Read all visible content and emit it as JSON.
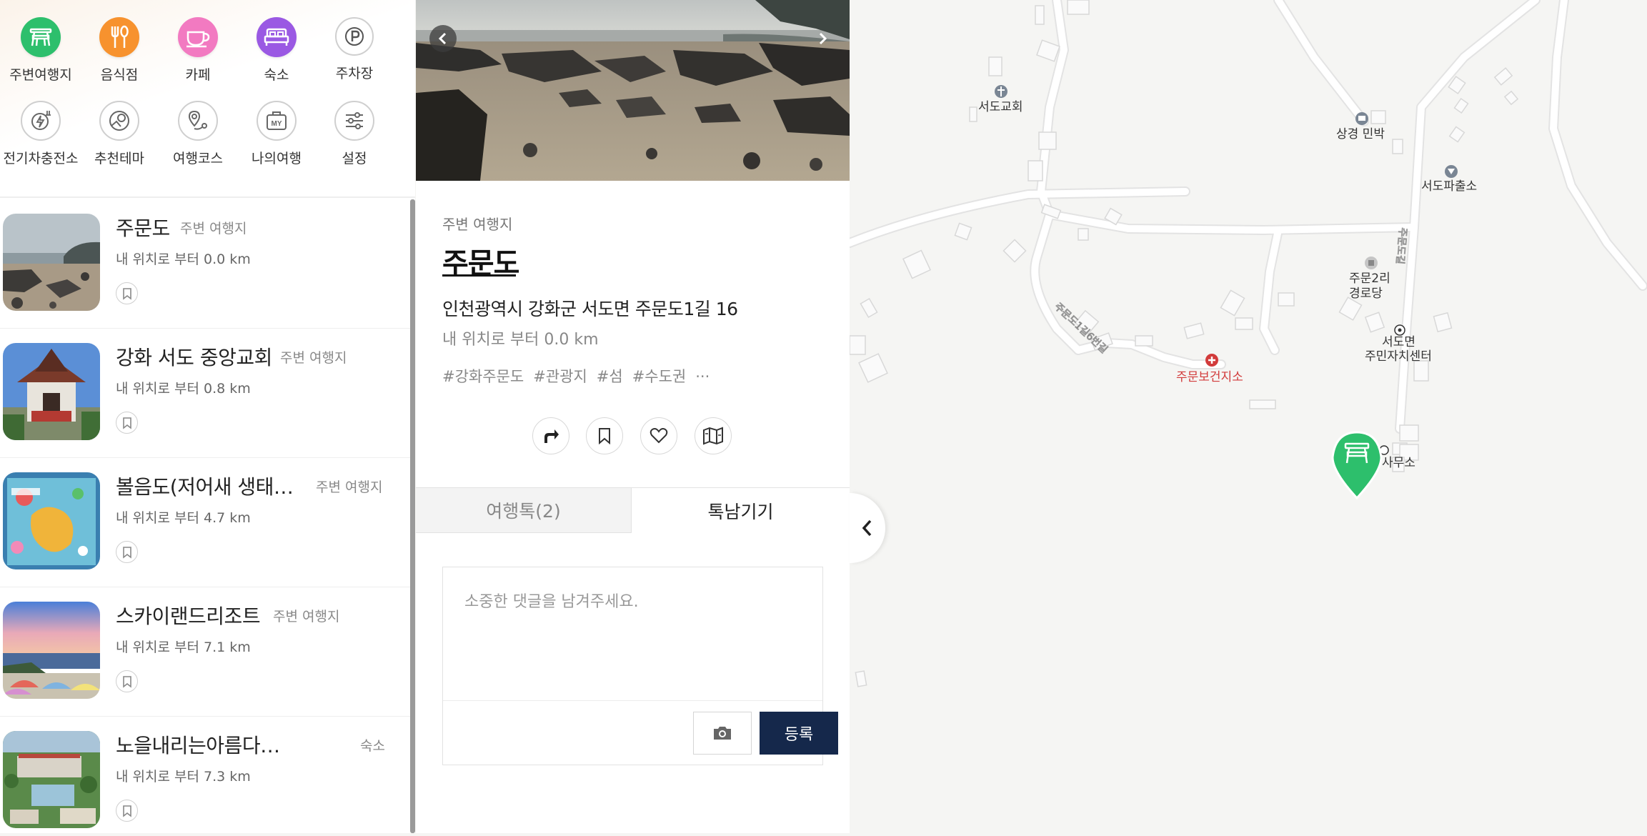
{
  "categories_row1": [
    {
      "label": "주변여행지",
      "icon": "picnic-table-icon",
      "color": "#2dbf6c"
    },
    {
      "label": "음식점",
      "icon": "fork-spoon-icon",
      "color": "#f7922e"
    },
    {
      "label": "카페",
      "icon": "coffee-cup-icon",
      "color": "#f27ac1"
    },
    {
      "label": "숙소",
      "icon": "bed-icon",
      "color": "#9a59e3"
    },
    {
      "label": "주차장",
      "icon": "parking-icon",
      "color": "#ffffff"
    }
  ],
  "categories_row2": [
    {
      "label": "전기차충전소",
      "icon": "ev-charger-icon"
    },
    {
      "label": "추천테마",
      "icon": "theme-compass-icon"
    },
    {
      "label": "여행코스",
      "icon": "route-pin-icon"
    },
    {
      "label": "나의여행",
      "icon": "my-bag-icon"
    },
    {
      "label": "설정",
      "icon": "settings-sliders-icon"
    }
  ],
  "list": {
    "items": [
      {
        "title": "주문도",
        "category": "주변 여행지",
        "distance": "내 위치로 부터 0.0 km"
      },
      {
        "title": "강화 서도 중앙교회",
        "category": "주변 여행지",
        "distance": "내 위치로 부터 0.8 km"
      },
      {
        "title": "볼음도(저어새 생태…",
        "category": "주변 여행지",
        "distance": "내 위치로 부터 4.7 km"
      },
      {
        "title": "스카이랜드리조트",
        "category": "주변 여행지",
        "distance": "내 위치로 부터 7.1 km"
      },
      {
        "title": "노을내리는아름다운집 [한…",
        "category": "숙소",
        "distance": "내 위치로 부터 7.3 km"
      }
    ]
  },
  "detail": {
    "category": "주변 여행지",
    "title": "주문도",
    "address": "인천광역시 강화군 서도면 주문도1길 16",
    "distance": "내 위치로 부터 0.0 km",
    "tags": [
      "#강화주문도",
      "#관광지",
      "#섬",
      "#수도권",
      "···"
    ],
    "actions": [
      "share-arrow-icon",
      "bookmark-icon",
      "heart-icon",
      "map-icon"
    ],
    "tabs": [
      "여행톡(2)",
      "톡남기기"
    ],
    "comment_placeholder": "소중한 댓글을 남겨주세요.",
    "register_label": "등록"
  },
  "map": {
    "labels": [
      "서도교회",
      "상경 민박",
      "서도파출소",
      "주문2리",
      "경로당",
      "서도면",
      "주민자치센터",
      "주문보건지소",
      "사무소",
      "주문도1길6번길",
      "주문도길"
    ],
    "marker_color": "#2dbf6c",
    "health_color": "#d23b3b"
  }
}
